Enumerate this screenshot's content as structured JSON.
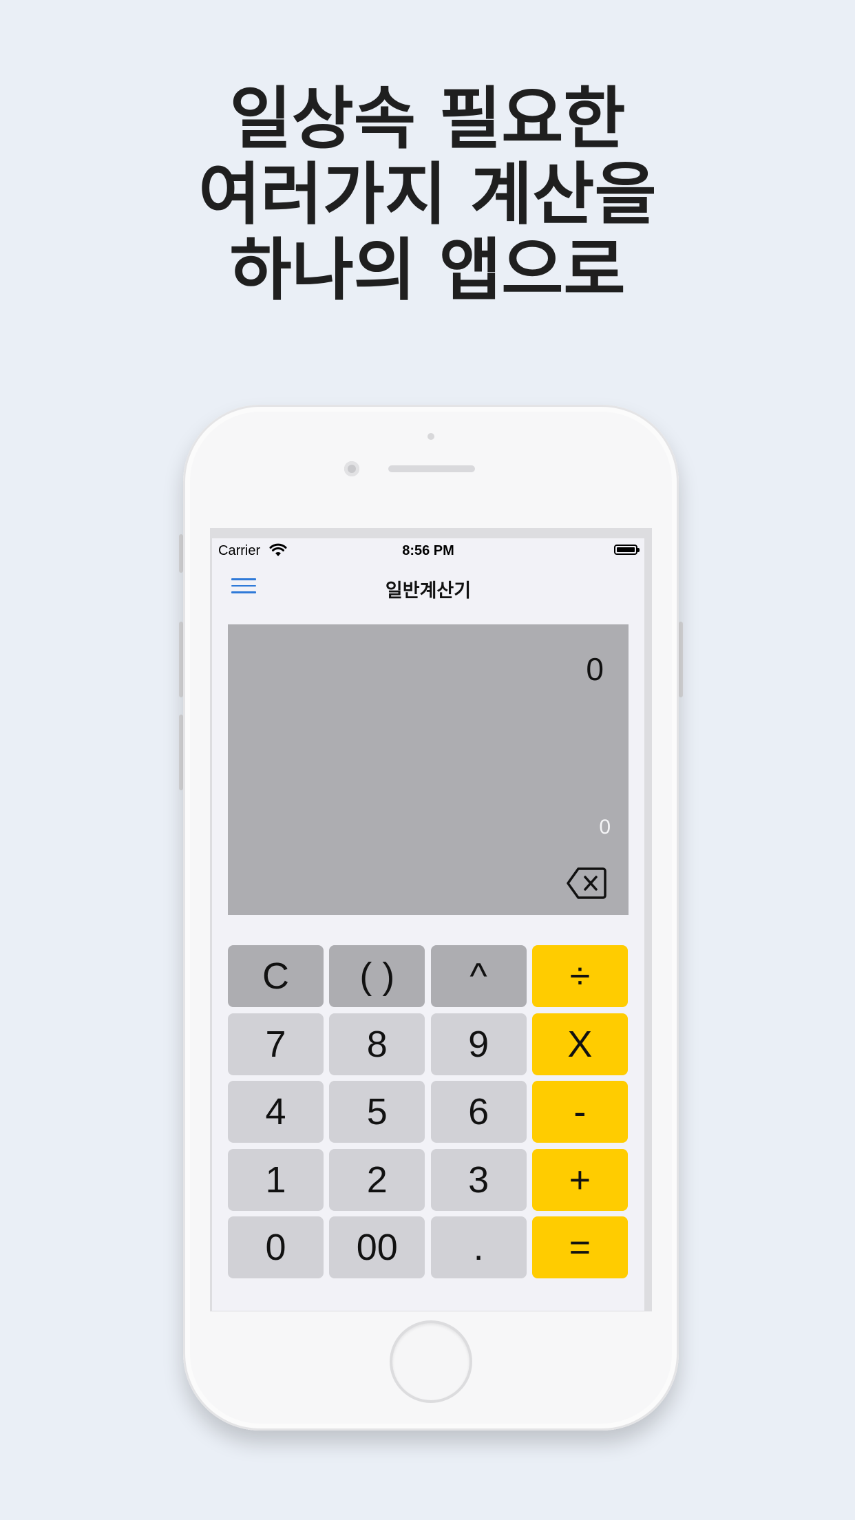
{
  "headline": {
    "line1": "일상속 필요한",
    "line2": "여러가지 계산을",
    "line3": "하나의 앱으로"
  },
  "status_bar": {
    "carrier": "Carrier",
    "time": "8:56 PM",
    "icons": [
      "wifi-icon",
      "battery-icon"
    ]
  },
  "nav": {
    "title": "일반계산기",
    "menu_icon": "hamburger-menu-icon",
    "accent": "#2f7ad8"
  },
  "display": {
    "expression": "0",
    "result": "0",
    "backspace_icon": "backspace-icon"
  },
  "keypad": {
    "colors": {
      "function": "#adadb1",
      "digit": "#d1d1d6",
      "operator": "#ffcc00"
    },
    "keys": [
      {
        "label": "C",
        "kind": "fn"
      },
      {
        "label": "( )",
        "kind": "fn"
      },
      {
        "label": "^",
        "kind": "fn"
      },
      {
        "label": "÷",
        "kind": "op"
      },
      {
        "label": "7",
        "kind": "num"
      },
      {
        "label": "8",
        "kind": "num"
      },
      {
        "label": "9",
        "kind": "num"
      },
      {
        "label": "X",
        "kind": "op"
      },
      {
        "label": "4",
        "kind": "num"
      },
      {
        "label": "5",
        "kind": "num"
      },
      {
        "label": "6",
        "kind": "num"
      },
      {
        "label": "-",
        "kind": "op"
      },
      {
        "label": "1",
        "kind": "num"
      },
      {
        "label": "2",
        "kind": "num"
      },
      {
        "label": "3",
        "kind": "num"
      },
      {
        "label": "+",
        "kind": "op"
      },
      {
        "label": "0",
        "kind": "num"
      },
      {
        "label": "00",
        "kind": "num"
      },
      {
        "label": ".",
        "kind": "num"
      },
      {
        "label": "=",
        "kind": "op"
      }
    ]
  }
}
